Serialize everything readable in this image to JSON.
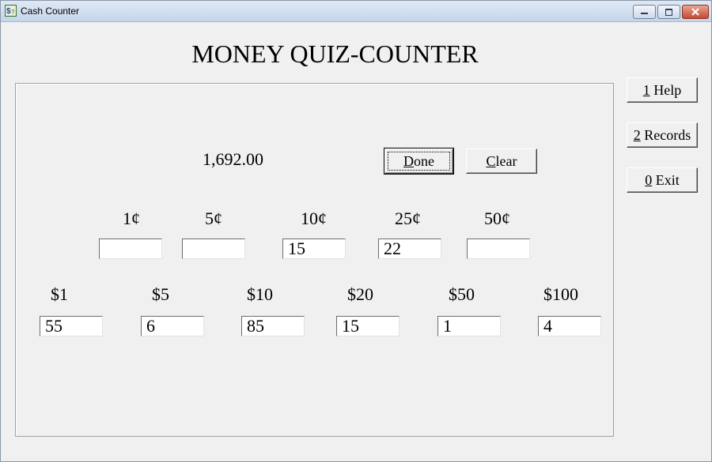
{
  "window": {
    "title": "Cash Counter",
    "icon": "app-icon"
  },
  "heading": "MONEY QUIZ-COUNTER",
  "total": "1,692.00",
  "buttons": {
    "done": {
      "key": "D",
      "rest": "one"
    },
    "clear": {
      "key": "C",
      "rest": "lear"
    },
    "help": {
      "key": "1",
      "rest": " Help"
    },
    "records": {
      "key": "2",
      "rest": " Records"
    },
    "exit": {
      "key": "0",
      "rest": " Exit"
    }
  },
  "coins": [
    {
      "label": "1¢",
      "value": ""
    },
    {
      "label": "5¢",
      "value": ""
    },
    {
      "label": "10¢",
      "value": "15"
    },
    {
      "label": "25¢",
      "value": "22"
    },
    {
      "label": "50¢",
      "value": ""
    }
  ],
  "bills": [
    {
      "label": "$1",
      "value": "55"
    },
    {
      "label": "$5",
      "value": "6"
    },
    {
      "label": "$10",
      "value": "85"
    },
    {
      "label": "$20",
      "value": "15"
    },
    {
      "label": "$50",
      "value": "1"
    },
    {
      "label": "$100",
      "value": "4"
    }
  ]
}
